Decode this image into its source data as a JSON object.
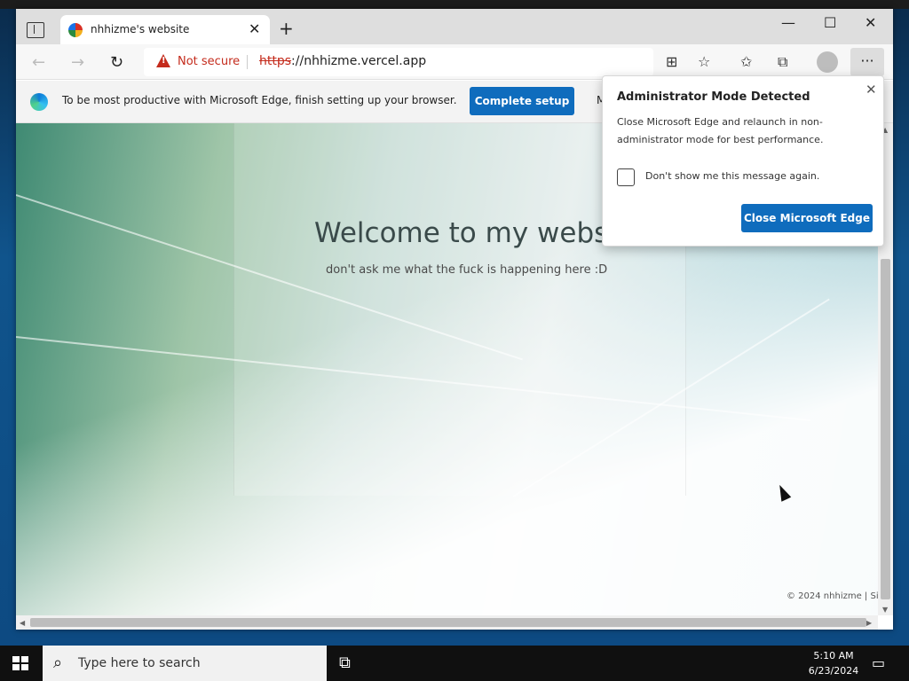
{
  "browser": {
    "tab_title": "nhhizme's website",
    "tab_close": "✕",
    "new_tab": "+",
    "window_controls": {
      "minimize": "—",
      "maximize": "☐",
      "close": "✕"
    },
    "address": {
      "security_label": "Not secure",
      "scheme": "https",
      "rest": "://nhhizme.vercel.app"
    },
    "toolbar_more": "···"
  },
  "infobar": {
    "message": "To be most productive with Microsoft Edge, finish setting up your browser.",
    "button": "Complete setup",
    "clipped": "M"
  },
  "page": {
    "heading": "Welcome to my website!",
    "subtitle": "don't ask me what the fuck is happening here :D",
    "footer": "© 2024 nhhizme | Si"
  },
  "popup": {
    "title": "Administrator Mode Detected",
    "body": "Close Microsoft Edge and relaunch in non-administrator mode for best performance.",
    "checkbox_label": "Don't show me this message again.",
    "checkbox_checked": false,
    "button": "Close Microsoft Edge"
  },
  "taskbar": {
    "search_placeholder": "Type here to search",
    "time": "5:10 AM",
    "date": "6/23/2024"
  },
  "icons": [
    "tab-actions-icon",
    "favicon-icon",
    "close-icon",
    "plus-icon",
    "back-icon",
    "forward-icon",
    "refresh-icon",
    "warning-icon",
    "apps-icon",
    "favorite-add-icon",
    "favorites-icon",
    "collections-icon",
    "profile-icon",
    "more-icon",
    "edge-logo-icon",
    "search-icon",
    "task-view-icon",
    "notification-icon",
    "windows-start-icon"
  ],
  "colors": {
    "accent": "#0f6cbd",
    "insecure": "#c42b1c"
  }
}
